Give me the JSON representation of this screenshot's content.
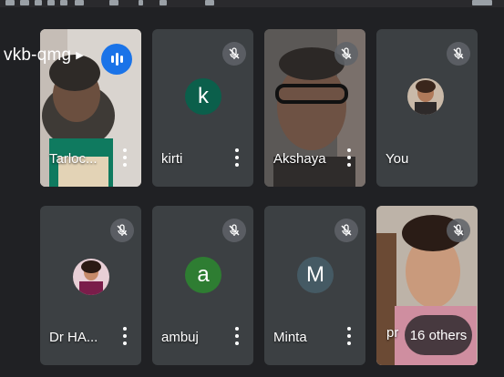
{
  "meeting": {
    "code_partial": "vkb-qmg"
  },
  "participants": [
    {
      "name": "Tarloc...",
      "type": "video",
      "speaking": true
    },
    {
      "name": "kirti",
      "type": "letter",
      "initial": "k",
      "avatar_color": "#0b5f4b",
      "muted": true
    },
    {
      "name": "Akshaya",
      "type": "video",
      "muted": true
    },
    {
      "name": "You",
      "type": "photo",
      "muted": true
    },
    {
      "name": "Dr HA...",
      "type": "photo",
      "muted": true
    },
    {
      "name": "ambuj",
      "type": "letter",
      "initial": "a",
      "avatar_color": "#2e7d32",
      "muted": true
    },
    {
      "name": "Minta",
      "type": "letter",
      "initial": "M",
      "avatar_color": "#455a64",
      "muted": true
    },
    {
      "name": "pr",
      "type": "video",
      "muted": true
    }
  ],
  "overflow": {
    "label": "16 others"
  },
  "colors": {
    "background": "#202124",
    "tile": "#3c4043",
    "speaking": "#1a73e8"
  }
}
